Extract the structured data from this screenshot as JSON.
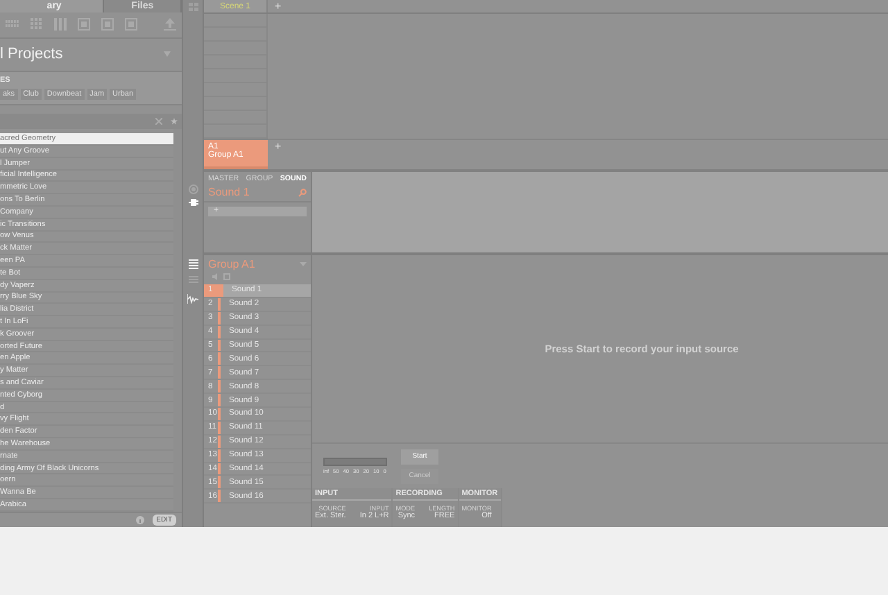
{
  "browser": {
    "tabs": [
      {
        "label": "ary",
        "selected": true
      },
      {
        "label": "Files",
        "selected": false
      }
    ],
    "title": "l Projects",
    "types_label": "ES",
    "tags": [
      {
        "label": "aks",
        "selected": false
      },
      {
        "label": "Club",
        "selected": false
      },
      {
        "label": "Downbeat",
        "selected": false
      },
      {
        "label": "Jam",
        "selected": false
      },
      {
        "label": "Urban",
        "selected": false
      }
    ],
    "results": [
      {
        "label": "acred Geometry",
        "selected": true
      },
      {
        "label": "ut Any Groove",
        "selected": false
      },
      {
        "label": "l Jumper",
        "selected": false
      },
      {
        "label": "ficial Intelligence",
        "selected": false
      },
      {
        "label": "mmetric Love",
        "selected": false
      },
      {
        "label": "ons To Berlin",
        "selected": false
      },
      {
        "label": "Company",
        "selected": false
      },
      {
        "label": "ic Transitions",
        "selected": false
      },
      {
        "label": "ow Venus",
        "selected": false
      },
      {
        "label": "ck Matter",
        "selected": false
      },
      {
        "label": "een PA",
        "selected": false
      },
      {
        "label": "te Bot",
        "selected": false
      },
      {
        "label": "dy Vaperz",
        "selected": false
      },
      {
        "label": "rry Blue Sky",
        "selected": false
      },
      {
        "label": "lia District",
        "selected": false
      },
      {
        "label": "t In LoFi",
        "selected": false
      },
      {
        "label": "k Groover",
        "selected": false
      },
      {
        "label": "orted Future",
        "selected": false
      },
      {
        "label": "en Apple",
        "selected": false
      },
      {
        "label": "y Matter",
        "selected": false
      },
      {
        "label": "s and Caviar",
        "selected": false
      },
      {
        "label": "nted Cyborg",
        "selected": false
      },
      {
        "label": "d",
        "selected": false
      },
      {
        "label": "vy Flight",
        "selected": false
      },
      {
        "label": "den Factor",
        "selected": false
      },
      {
        "label": "he Warehouse",
        "selected": false
      },
      {
        "label": "rnate",
        "selected": false
      },
      {
        "label": "ding Army Of Black Unicorns",
        "selected": false
      },
      {
        "label": "oern",
        "selected": false
      },
      {
        "label": "Wanna Be",
        "selected": false
      },
      {
        "label": "Arabica",
        "selected": false
      }
    ],
    "edit_button": "EDIT"
  },
  "arranger": {
    "scenes": [
      {
        "label": "Scene 1",
        "selected": true
      }
    ],
    "scene_add": "+",
    "groups": [
      {
        "code": "A1",
        "name": "Group A1",
        "selected": true
      }
    ],
    "group_add": "+"
  },
  "plugin_panel": {
    "tabs": [
      {
        "label": "MASTER",
        "selected": false
      },
      {
        "label": "GROUP",
        "selected": false
      },
      {
        "label": "SOUND",
        "selected": true
      }
    ],
    "title": "Sound 1",
    "slot": "+"
  },
  "group": {
    "title": "Group A1",
    "sounds": [
      {
        "number": "1",
        "name": "Sound 1",
        "selected": true
      },
      {
        "number": "2",
        "name": "Sound 2",
        "selected": false
      },
      {
        "number": "3",
        "name": "Sound 3",
        "selected": false
      },
      {
        "number": "4",
        "name": "Sound 4",
        "selected": false
      },
      {
        "number": "5",
        "name": "Sound 5",
        "selected": false
      },
      {
        "number": "6",
        "name": "Sound 6",
        "selected": false
      },
      {
        "number": "7",
        "name": "Sound 7",
        "selected": false
      },
      {
        "number": "8",
        "name": "Sound 8",
        "selected": false
      },
      {
        "number": "9",
        "name": "Sound 9",
        "selected": false
      },
      {
        "number": "10",
        "name": "Sound 10",
        "selected": false
      },
      {
        "number": "11",
        "name": "Sound 11",
        "selected": false
      },
      {
        "number": "12",
        "name": "Sound 12",
        "selected": false
      },
      {
        "number": "13",
        "name": "Sound 13",
        "selected": false
      },
      {
        "number": "14",
        "name": "Sound 14",
        "selected": false
      },
      {
        "number": "15",
        "name": "Sound 15",
        "selected": false
      },
      {
        "number": "16",
        "name": "Sound 16",
        "selected": false
      }
    ]
  },
  "sampling": {
    "message": "Press Start to record your input source",
    "meter_scale": [
      "inf",
      "50",
      "40",
      "30",
      "20",
      "10",
      "0"
    ],
    "start": "Start",
    "cancel": "Cancel",
    "cancel_disabled": true,
    "sections": [
      {
        "title": "INPUT",
        "fields": [
          {
            "label": "SOURCE",
            "value": "Ext. Ster."
          },
          {
            "label": "INPUT",
            "value": "In 2 L+R"
          }
        ]
      },
      {
        "title": "RECORDING",
        "fields": [
          {
            "label": "MODE",
            "value": "Sync"
          },
          {
            "label": "LENGTH",
            "value": "FREE"
          }
        ]
      },
      {
        "title": "MONITOR",
        "fields": [
          {
            "label": "MONITOR",
            "value": "Off"
          }
        ]
      }
    ]
  }
}
